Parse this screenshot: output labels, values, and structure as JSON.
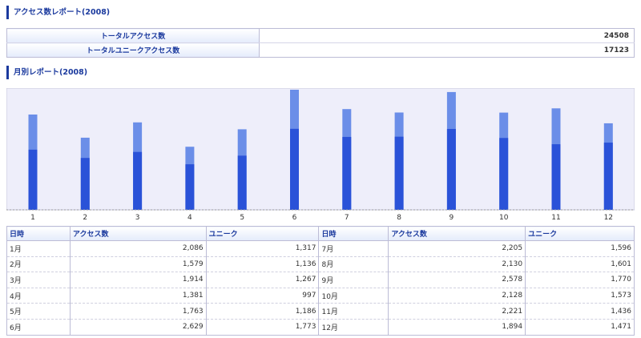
{
  "report": {
    "title": "アクセス数レポート(2008)",
    "summary": [
      {
        "label": "トータルアクセス数",
        "value": "24508"
      },
      {
        "label": "トータルユニークアクセス数",
        "value": "17123"
      }
    ]
  },
  "monthly": {
    "title": "月別レポート(2008)",
    "headers": [
      "日時",
      "アクセス数",
      "ユニーク",
      "日時",
      "アクセス数",
      "ユニーク"
    ],
    "rows_left": [
      [
        "1月",
        "2,086",
        "1,317"
      ],
      [
        "2月",
        "1,579",
        "1,136"
      ],
      [
        "3月",
        "1,914",
        "1,267"
      ],
      [
        "4月",
        "1,381",
        "997"
      ],
      [
        "5月",
        "1,763",
        "1,186"
      ],
      [
        "6月",
        "2,629",
        "1,773"
      ]
    ],
    "rows_right": [
      [
        "7月",
        "2,205",
        "1,596"
      ],
      [
        "8月",
        "2,130",
        "1,601"
      ],
      [
        "9月",
        "2,578",
        "1,770"
      ],
      [
        "10月",
        "2,128",
        "1,573"
      ],
      [
        "11月",
        "2,221",
        "1,436"
      ],
      [
        "12月",
        "1,894",
        "1,471"
      ]
    ]
  },
  "colors": {
    "accent": "#1b3a9e",
    "chart_bg": "#eeeefa",
    "bar_access": "#6b8ee8",
    "bar_unique": "#2a52d8"
  },
  "chart_data": {
    "type": "bar",
    "categories": [
      "1",
      "2",
      "3",
      "4",
      "5",
      "6",
      "7",
      "8",
      "9",
      "10",
      "11",
      "12"
    ],
    "series": [
      {
        "values": [
          2086,
          1579,
          1914,
          1381,
          1763,
          2629,
          2205,
          2130,
          2578,
          2128,
          2221,
          1894
        ]
      },
      {
        "values": [
          1317,
          1136,
          1267,
          997,
          1186,
          1773,
          1596,
          1601,
          1770,
          1573,
          1436,
          1471
        ]
      }
    ],
    "ylim": [
      0,
      2629
    ],
    "grid": false,
    "legend": "none"
  }
}
